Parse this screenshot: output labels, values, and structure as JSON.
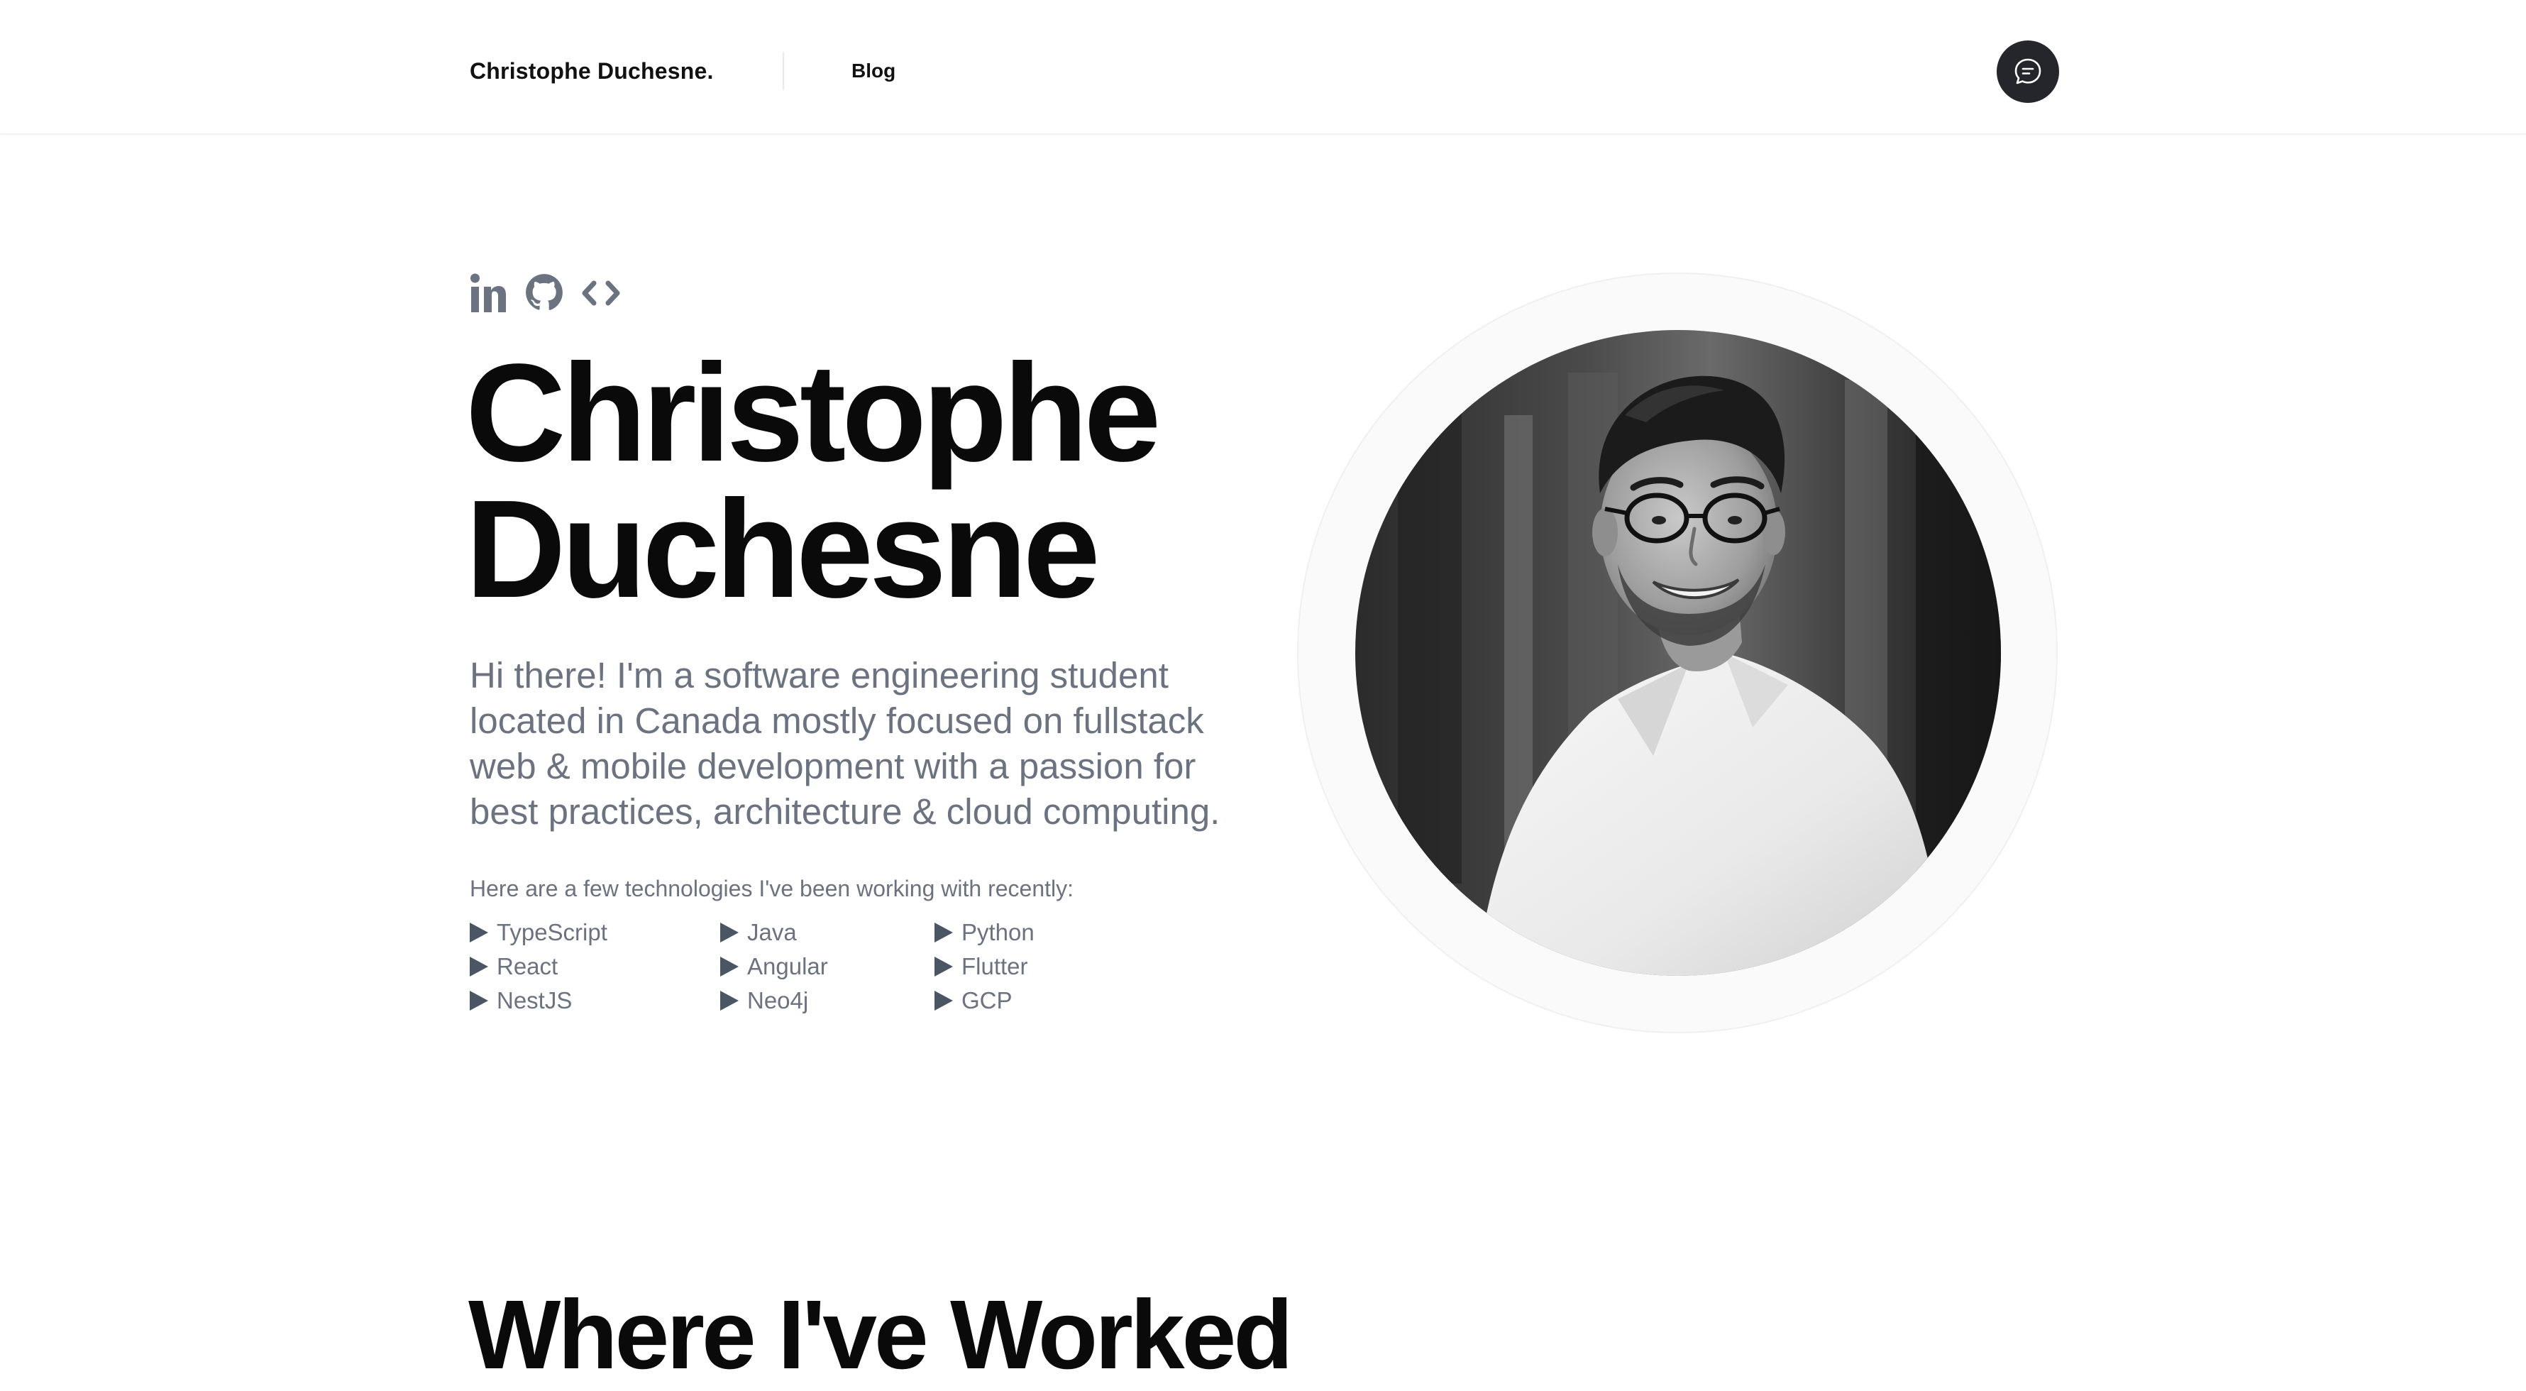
{
  "header": {
    "brand": "Christophe Duchesne.",
    "nav": {
      "blog_label": "Blog"
    },
    "chat_icon": "chat-bubble-icon"
  },
  "hero": {
    "socials": [
      {
        "icon": "linkedin-icon"
      },
      {
        "icon": "github-icon"
      },
      {
        "icon": "code-icon"
      }
    ],
    "name_first": "Christophe",
    "name_last": "Duchesne",
    "intro": "Hi there! I'm a software engineering student located in Canada mostly focused on fullstack web & mobile development with a passion for best practices, architecture & cloud computing.",
    "tech_intro": "Here are a few technologies I've been working with recently:",
    "technologies": [
      "TypeScript",
      "Java",
      "Python",
      "React",
      "Angular",
      "Flutter",
      "NestJS",
      "Neo4j",
      "GCP"
    ]
  },
  "sections": {
    "experience_heading": "Where I've Worked"
  },
  "colors": {
    "text_primary": "#0a0a0a",
    "text_muted": "#6b7280",
    "icon_gray": "#6b7280",
    "chat_button_bg": "#24262b",
    "portrait_ring": "#fafafa"
  }
}
